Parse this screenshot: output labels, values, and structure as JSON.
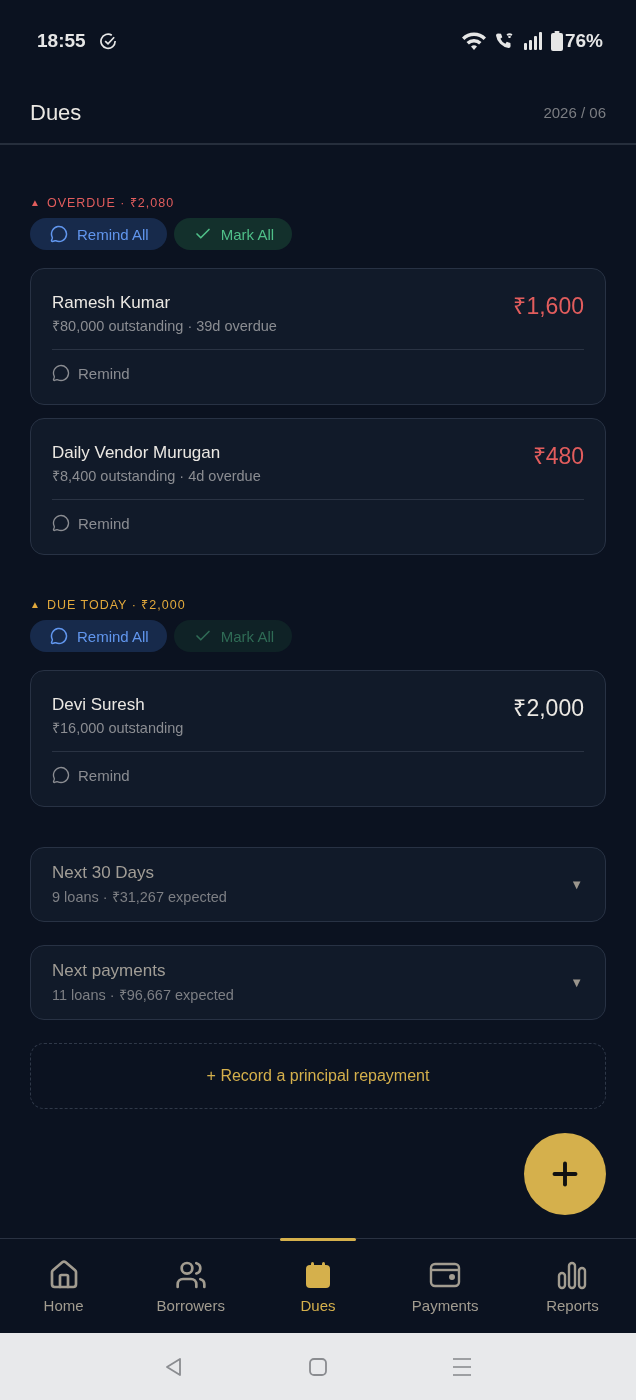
{
  "status_bar": {
    "time": "18:55",
    "battery": "76%"
  },
  "header": {
    "title": "Dues",
    "period": "2026 / 06"
  },
  "sections": [
    {
      "kind": "overdue",
      "marker": "▲",
      "heading": "OVERDUE · ₹2,080",
      "actions": [
        {
          "kind": "remind",
          "label": "Remind All",
          "disabled": false
        },
        {
          "kind": "mark",
          "label": "Mark All",
          "disabled": false
        }
      ],
      "items": [
        {
          "name": "Ramesh Kumar",
          "details": "₹80,000 outstanding · 39d overdue",
          "amount": "₹1,600",
          "action": "Remind"
        },
        {
          "name": "Daily Vendor Murugan",
          "details": "₹8,400 outstanding · 4d overdue",
          "amount": "₹480",
          "action": "Remind"
        }
      ]
    },
    {
      "kind": "due_today",
      "marker": "▲",
      "heading": "DUE TODAY · ₹2,000",
      "actions": [
        {
          "kind": "remind",
          "label": "Remind All",
          "disabled": false
        },
        {
          "kind": "mark",
          "label": "Mark All",
          "disabled": true
        }
      ],
      "items": [
        {
          "name": "Devi Suresh",
          "details": "₹16,000 outstanding",
          "amount": "₹2,000",
          "action": "Remind"
        }
      ]
    }
  ],
  "groups": [
    {
      "title": "Next 30 Days",
      "details": "9 loans · ₹31,267 expected",
      "indicator": "▼",
      "expanded": false
    },
    {
      "title": "Next payments",
      "details": "11 loans · ₹96,667 expected",
      "indicator": "▼",
      "expanded": false
    }
  ],
  "record_button": {
    "label": "+ Record a principal repayment"
  },
  "nav": [
    {
      "label": "Home",
      "selected": false
    },
    {
      "label": "Borrowers",
      "selected": false
    },
    {
      "label": "Dues",
      "selected": true
    },
    {
      "label": "Payments",
      "selected": false
    },
    {
      "label": "Reports",
      "selected": false
    }
  ]
}
